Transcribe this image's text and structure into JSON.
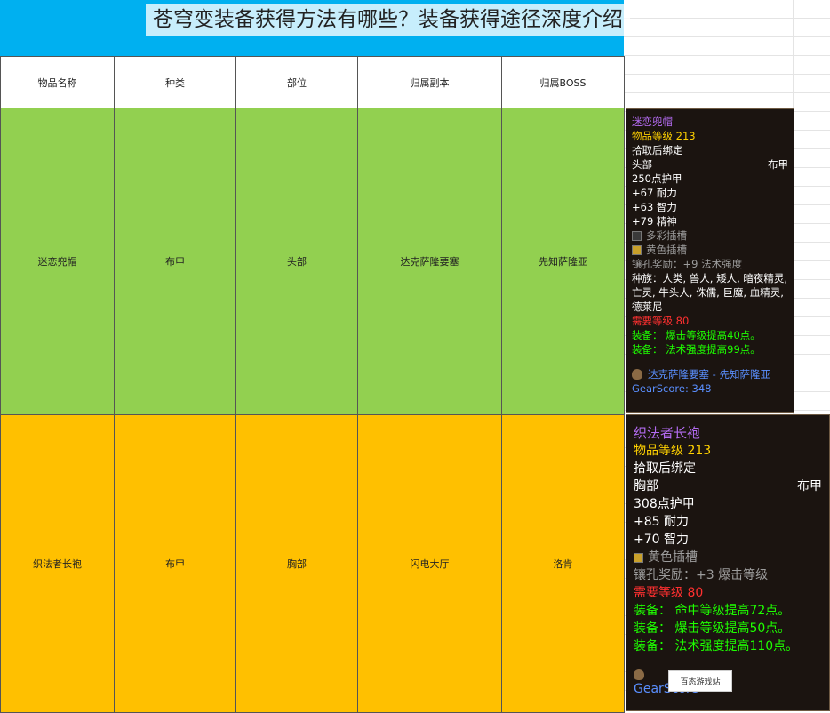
{
  "title": "苍穹变装备获得方法有哪些？装备获得途径深度介绍",
  "table": {
    "headers": [
      "物品名称",
      "种类",
      "部位",
      "归属副本",
      "归属BOSS"
    ],
    "rows": [
      [
        "迷恋兜帽",
        "布甲",
        "头部",
        "达克萨隆要塞",
        "先知萨隆亚"
      ],
      [
        "织法者长袍",
        "布甲",
        "胸部",
        "闪电大厅",
        "洛肯"
      ]
    ]
  },
  "colors": {
    "banner": "#00b0f0",
    "row1": "#92d050",
    "row2": "#ffc000"
  },
  "tooltip1": {
    "name": "迷恋兜帽",
    "item_level": "物品等级 213",
    "bind": "拾取后绑定",
    "slot": "头部",
    "type": "布甲",
    "armor": "250点护甲",
    "stat1": "+67 耐力",
    "stat2": "+63 智力",
    "stat3": "+79 精神",
    "socket1": "多彩插槽",
    "socket2": "黄色插槽",
    "socket_bonus": "镶孔奖励：+9 法术强度",
    "races": "种族：人类, 兽人, 矮人, 暗夜精灵, 亡灵, 牛头人, 侏儒, 巨魔, 血精灵, 德莱尼",
    "req_level": "需要等级 80",
    "equip1": "装备： 爆击等级提高40点。",
    "equip2": "装备： 法术强度提高99点。",
    "source": "达克萨隆要塞 - 先知萨隆亚",
    "gearscore": "GearScore: 348"
  },
  "tooltip2": {
    "name": "织法者长袍",
    "item_level": "物品等级 213",
    "bind": "拾取后绑定",
    "slot": "胸部",
    "type": "布甲",
    "armor": "308点护甲",
    "stat1": "+85 耐力",
    "stat2": "+70 智力",
    "socket1": "黄色插槽",
    "socket_bonus": "镶孔奖励：+3 爆击等级",
    "req_level": "需要等级 80",
    "equip1": "装备： 命中等级提高72点。",
    "equip2": "装备： 爆击等级提高50点。",
    "equip3": "装备： 法术强度提高110点。",
    "gearscore": "GearScore"
  },
  "watermark": "百态游戏站"
}
